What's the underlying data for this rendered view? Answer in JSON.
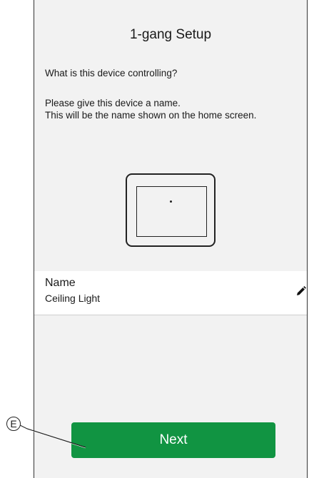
{
  "screen": {
    "title": "1-gang Setup",
    "question": "What is this device controlling?",
    "instructions_line1": "Please give this device a name.",
    "instructions_line2": "This will be the name shown on the home screen."
  },
  "name_field": {
    "label": "Name",
    "value": "Ceiling Light",
    "edit_icon": "pencil-icon"
  },
  "device_illustration": {
    "icon": "1-gang-switch-icon"
  },
  "actions": {
    "next_label": "Next"
  },
  "callout": {
    "label": "E"
  },
  "colors": {
    "primary_button": "#119442",
    "background": "#f2f2f2",
    "row_background": "#ffffff"
  }
}
